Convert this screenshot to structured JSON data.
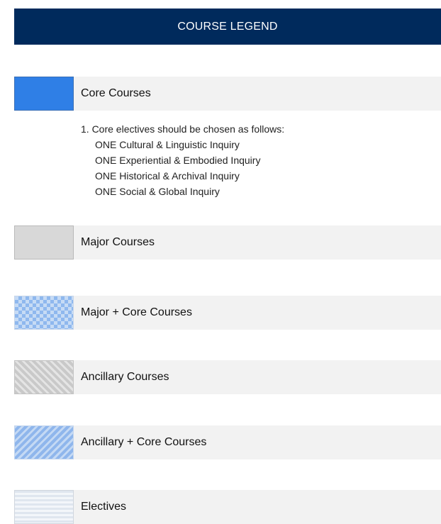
{
  "header": {
    "title": "COURSE LEGEND"
  },
  "legend": [
    {
      "label": "Core Courses",
      "swatch": "solid-blue",
      "color": "#2f7fe6"
    },
    {
      "label": "Major Courses",
      "swatch": "solid-gray",
      "color": "#d8d8d8"
    },
    {
      "label": "Major + Core Courses",
      "swatch": "checker-blue",
      "color": "#8fb8ee"
    },
    {
      "label": "Ancillary Courses",
      "swatch": "diagonal-gray",
      "color": "#c9c9c9"
    },
    {
      "label": "Ancillary + Core Courses",
      "swatch": "diagonal-blue",
      "color": "#8fb6ec"
    },
    {
      "label": "Electives",
      "swatch": "horizontal-stripes-light",
      "color": "#dfe6ef"
    }
  ],
  "core_notes": {
    "intro": "1. Core electives should be chosen as follows:",
    "items": [
      "ONE Cultural & Linguistic Inquiry",
      "ONE Experiential & Embodied Inquiry",
      "ONE Historical & Archival Inquiry",
      "ONE Social & Global Inquiry"
    ]
  },
  "colors": {
    "header_bg": "#002a5c",
    "label_bg": "#f2f2f2"
  }
}
